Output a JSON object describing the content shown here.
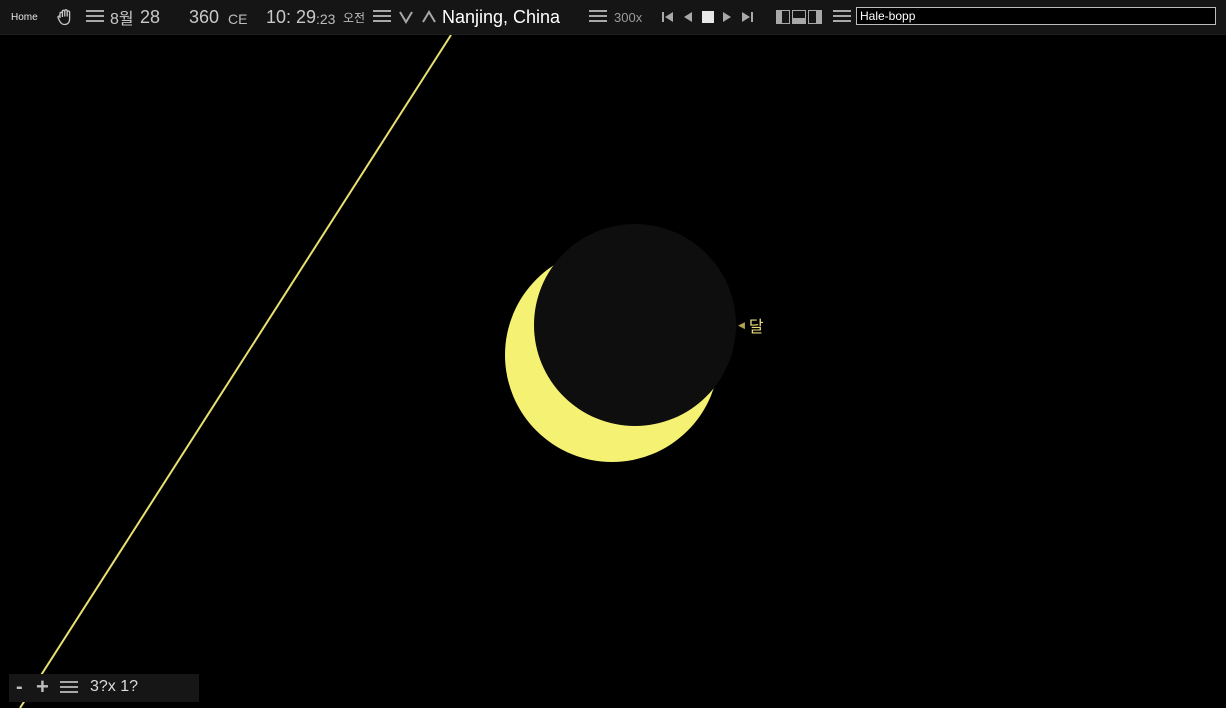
{
  "toolbar": {
    "home_label": "Home",
    "month_label": "8월",
    "day": "28",
    "year": "360",
    "era": "CE",
    "hour_min": "10: 29",
    "seconds": ":23",
    "ampm": "오전",
    "location": "Nanjing, China",
    "speed": "300x"
  },
  "search": {
    "value": "Hale-bopp"
  },
  "sky": {
    "moon_label": "달",
    "moon_color": "#f5f173",
    "line_color": "#e8e070"
  },
  "zoom": {
    "minus": "-",
    "plus": "+",
    "fov": "3?x 1?"
  }
}
